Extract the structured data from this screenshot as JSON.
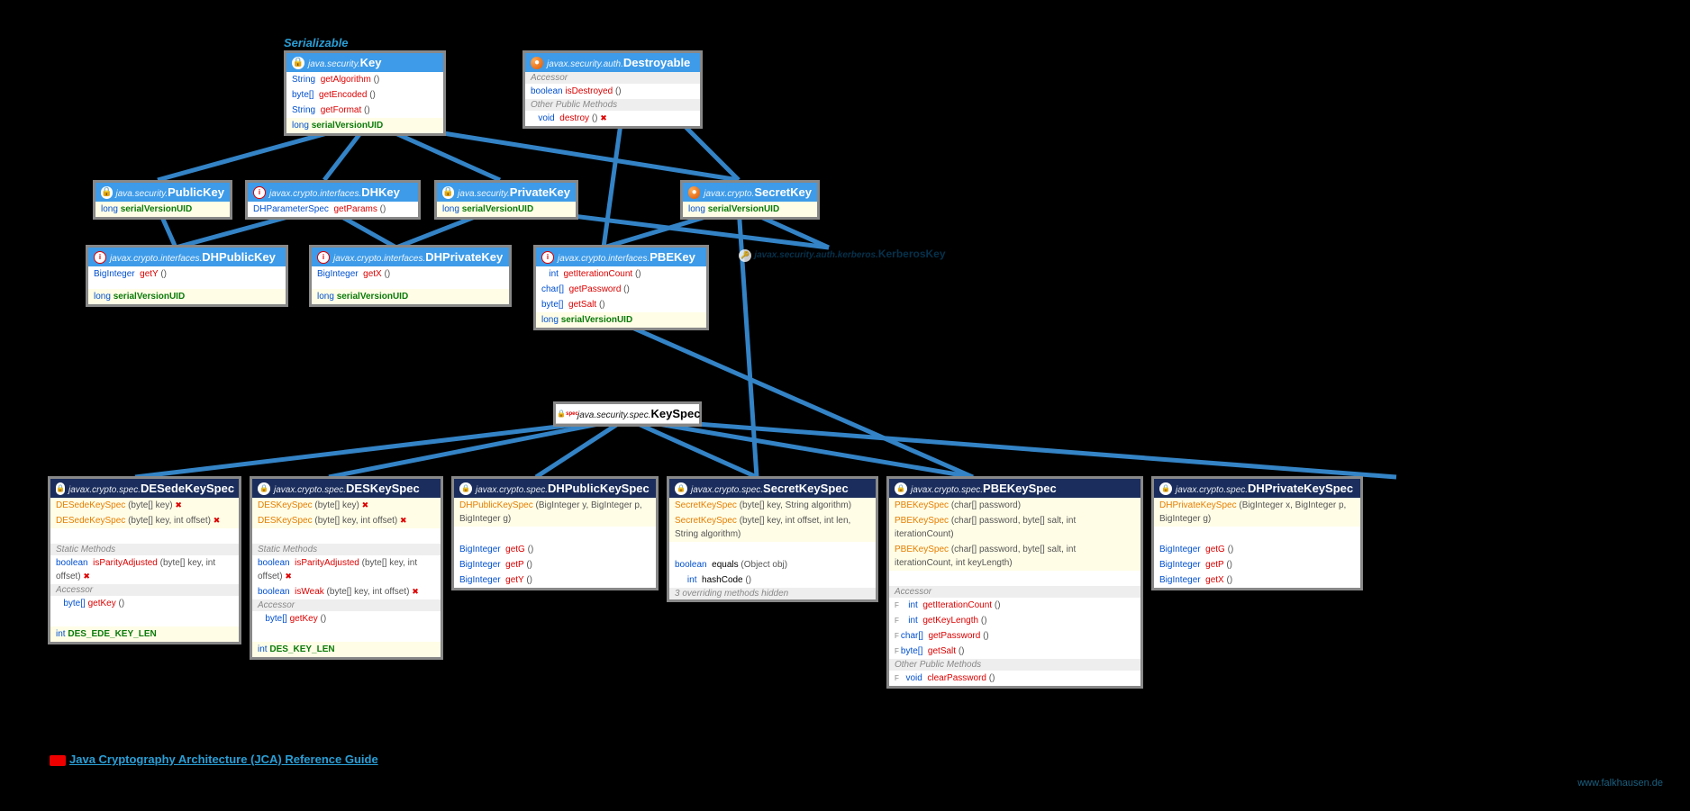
{
  "serLabel": "Serializable",
  "key": {
    "pkg": "java.security.",
    "name": "Key",
    "m": [
      [
        "String",
        "getAlgorithm",
        "()"
      ],
      [
        "byte[]",
        "getEncoded",
        "()"
      ],
      [
        "String",
        "getFormat",
        "()"
      ]
    ],
    "f": "long serialVersionUID"
  },
  "dest": {
    "pkg": "javax.security.auth.",
    "name": "Destroyable",
    "acc": "Accessor",
    "m1": [
      "boolean",
      "isDestroyed",
      "()"
    ],
    "oth": "Other Public Methods",
    "m2": [
      "void",
      "destroy",
      "() ",
      "x"
    ]
  },
  "pub": {
    "pkg": "java.security.",
    "name": "PublicKey",
    "f": "long serialVersionUID"
  },
  "dhk": {
    "pkg": "javax.crypto.interfaces.",
    "name": "DHKey",
    "m": [
      "DHParameterSpec",
      "getParams",
      "()"
    ]
  },
  "priv": {
    "pkg": "java.security.",
    "name": "PrivateKey",
    "f": "long serialVersionUID"
  },
  "sec": {
    "pkg": "javax.crypto.",
    "name": "SecretKey",
    "f": "long serialVersionUID"
  },
  "dhpub": {
    "pkg": "javax.crypto.interfaces.",
    "name": "DHPublicKey",
    "m": [
      "BigInteger",
      "getY",
      "()"
    ],
    "f": "long serialVersionUID"
  },
  "dhpriv": {
    "pkg": "javax.crypto.interfaces.",
    "name": "DHPrivateKey",
    "m": [
      "BigInteger",
      "getX",
      "()"
    ],
    "f": "long serialVersionUID"
  },
  "pbe": {
    "pkg": "javax.crypto.interfaces.",
    "name": "PBEKey",
    "m": [
      [
        "int",
        "getIterationCount",
        "()"
      ],
      [
        "char[]",
        "getPassword",
        "()"
      ],
      [
        "byte[]",
        "getSalt",
        "()"
      ]
    ],
    "f": "long serialVersionUID"
  },
  "kerb": {
    "pkg": "javax.security.auth.kerberos.",
    "name": "KerberosKey"
  },
  "keyspec": {
    "pkg": "java.security.spec.",
    "name": "KeySpec"
  },
  "desede": {
    "pkg": "javax.crypto.spec.",
    "name": "DESedeKeySpec",
    "c": [
      [
        "DESedeKeySpec",
        "(byte[] key) ",
        "x"
      ],
      [
        "DESedeKeySpec",
        "(byte[] key, int offset) ",
        "x"
      ]
    ],
    "sm": "Static Methods",
    "s": [
      "boolean",
      "isParityAdjusted",
      "(byte[] key, int offset) ",
      "x"
    ],
    "acc": "Accessor",
    "a": [
      "byte[]",
      "getKey",
      "()"
    ],
    "f": "int DES_EDE_KEY_LEN"
  },
  "des": {
    "pkg": "javax.crypto.spec.",
    "name": "DESKeySpec",
    "c": [
      [
        "DESKeySpec",
        "(byte[] key) ",
        "x"
      ],
      [
        "DESKeySpec",
        "(byte[] key, int offset) ",
        "x"
      ]
    ],
    "sm": "Static Methods",
    "s": [
      [
        "boolean",
        "isParityAdjusted",
        "(byte[] key, int offset) ",
        "x"
      ],
      [
        "boolean",
        "isWeak",
        "(byte[] key, int offset) ",
        "x"
      ]
    ],
    "acc": "Accessor",
    "a": [
      "byte[]",
      "getKey",
      "()"
    ],
    "f": "int DES_KEY_LEN"
  },
  "dhpubspec": {
    "pkg": "javax.crypto.spec.",
    "name": "DHPublicKeySpec",
    "c": [
      "DHPublicKeySpec",
      "(BigInteger y, BigInteger p, BigInteger g)"
    ],
    "m": [
      [
        "BigInteger",
        "getG",
        "()"
      ],
      [
        "BigInteger",
        "getP",
        "()"
      ],
      [
        "BigInteger",
        "getY",
        "()"
      ]
    ]
  },
  "sks": {
    "pkg": "javax.crypto.spec.",
    "name": "SecretKeySpec",
    "c": [
      [
        "SecretKeySpec",
        "(byte[] key, String algorithm)"
      ],
      [
        "SecretKeySpec",
        "(byte[] key, int offset, int len, String algorithm)"
      ]
    ],
    "m": [
      [
        "boolean",
        "equals",
        "(Object obj)"
      ],
      [
        "int",
        "hashCode",
        "()"
      ]
    ],
    "note": "3 overriding methods hidden"
  },
  "pbespec": {
    "pkg": "javax.crypto.spec.",
    "name": "PBEKeySpec",
    "c": [
      [
        "PBEKeySpec",
        "(char[] password)"
      ],
      [
        "PBEKeySpec",
        "(char[] password, byte[] salt, int iterationCount)"
      ],
      [
        "PBEKeySpec",
        "(char[] password, byte[] salt, int iterationCount, int keyLength)"
      ]
    ],
    "acc": "Accessor",
    "a": [
      [
        "int",
        "getIterationCount",
        "()"
      ],
      [
        "int",
        "getKeyLength",
        "()"
      ],
      [
        "char[]",
        "getPassword",
        "()"
      ],
      [
        "byte[]",
        "getSalt",
        "()"
      ]
    ],
    "oth": "Other Public Methods",
    "o": [
      "void",
      "clearPassword",
      "()"
    ]
  },
  "dhprivspec": {
    "pkg": "javax.crypto.spec.",
    "name": "DHPrivateKeySpec",
    "c": [
      "DHPrivateKeySpec",
      "(BigInteger x, BigInteger p, BigInteger g)"
    ],
    "m": [
      [
        "BigInteger",
        "getG",
        "()"
      ],
      [
        "BigInteger",
        "getP",
        "()"
      ],
      [
        "BigInteger",
        "getX",
        "()"
      ]
    ]
  },
  "link": "Java Cryptography Architecture (JCA) Reference Guide",
  "wm": "www.falkhausen.de"
}
